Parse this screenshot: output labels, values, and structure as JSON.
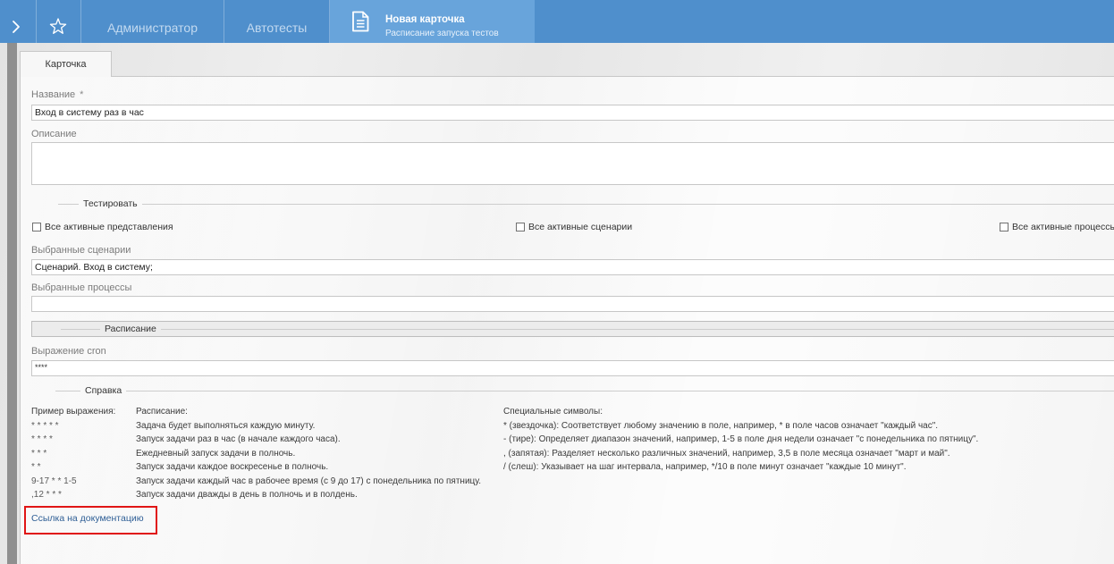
{
  "colors": {
    "topbar": "#4f8fcc",
    "active_tab": "#68a4db",
    "tab_text": "#c3daf0",
    "link": "#2e5e95",
    "highlight": "#e01515"
  },
  "topbar": {
    "nav_icon": "chevron-right-icon",
    "favorites_icon": "star-icon",
    "tabs": [
      {
        "label": "Администратор"
      },
      {
        "label": "Автотесты"
      }
    ],
    "active_tab": {
      "icon": "document-icon",
      "title": "Новая карточка",
      "subtitle": "Расписание запуска тестов"
    }
  },
  "card_tabs": [
    {
      "label": "Карточка",
      "selected": true
    }
  ],
  "form": {
    "name": {
      "label": "Название",
      "required_mark": "*",
      "value": "Вход в систему раз в час"
    },
    "description": {
      "label": "Описание",
      "value": ""
    },
    "testing_section": {
      "title": "Тестировать",
      "checkboxes": [
        {
          "label": "Все активные представления",
          "checked": false
        },
        {
          "label": "Все активные сценарии",
          "checked": false
        },
        {
          "label": "Все активные процессы",
          "checked": false
        }
      ],
      "selected_scenarios": {
        "label": "Выбранные сценарии",
        "value": "Сценарий. Вход в систему;"
      },
      "selected_processes": {
        "label": "Выбранные процессы",
        "value": ""
      }
    },
    "schedule_section": {
      "title": "Расписание",
      "cron": {
        "label": "Выражение cron",
        "value": "****"
      }
    },
    "help_section": {
      "title": "Справка",
      "examples_header": "Пример выражения:",
      "schedule_header": "Расписание:",
      "examples": [
        {
          "expression": "* * * * *",
          "description": "Задача будет выполняться каждую минуту."
        },
        {
          "expression": "* * * *",
          "description": "Запуск задачи раз в час (в начале каждого часа)."
        },
        {
          "expression": "* * *",
          "description": "Ежедневный запуск задачи в полночь."
        },
        {
          "expression": "* *",
          "description": "Запуск задачи каждое воскресенье в полночь."
        },
        {
          "expression": "9-17 * * 1-5",
          "description": "Запуск задачи каждый час в рабочее время (с 9 до 17) с понедельника по пятницу."
        },
        {
          "expression": ",12 * * *",
          "description": "Запуск задачи дважды в день в полночь и в полдень."
        }
      ],
      "special_header": "Специальные символы:",
      "special_symbols": [
        "* (звездочка): Соответствует любому значению в поле, например, * в поле часов означает \"каждый час\".",
        "- (тире): Определяет диапазон значений, например, 1-5 в поле дня недели означает \"с понедельника по пятницу\".",
        ", (запятая): Разделяет несколько различных значений, например, 3,5 в поле месяца означает \"март и май\".",
        "/ (слеш): Указывает на шаг интервала, например, */10 в поле минут означает \"каждые 10 минут\"."
      ],
      "docs_link": "Ссылка на документацию"
    }
  }
}
